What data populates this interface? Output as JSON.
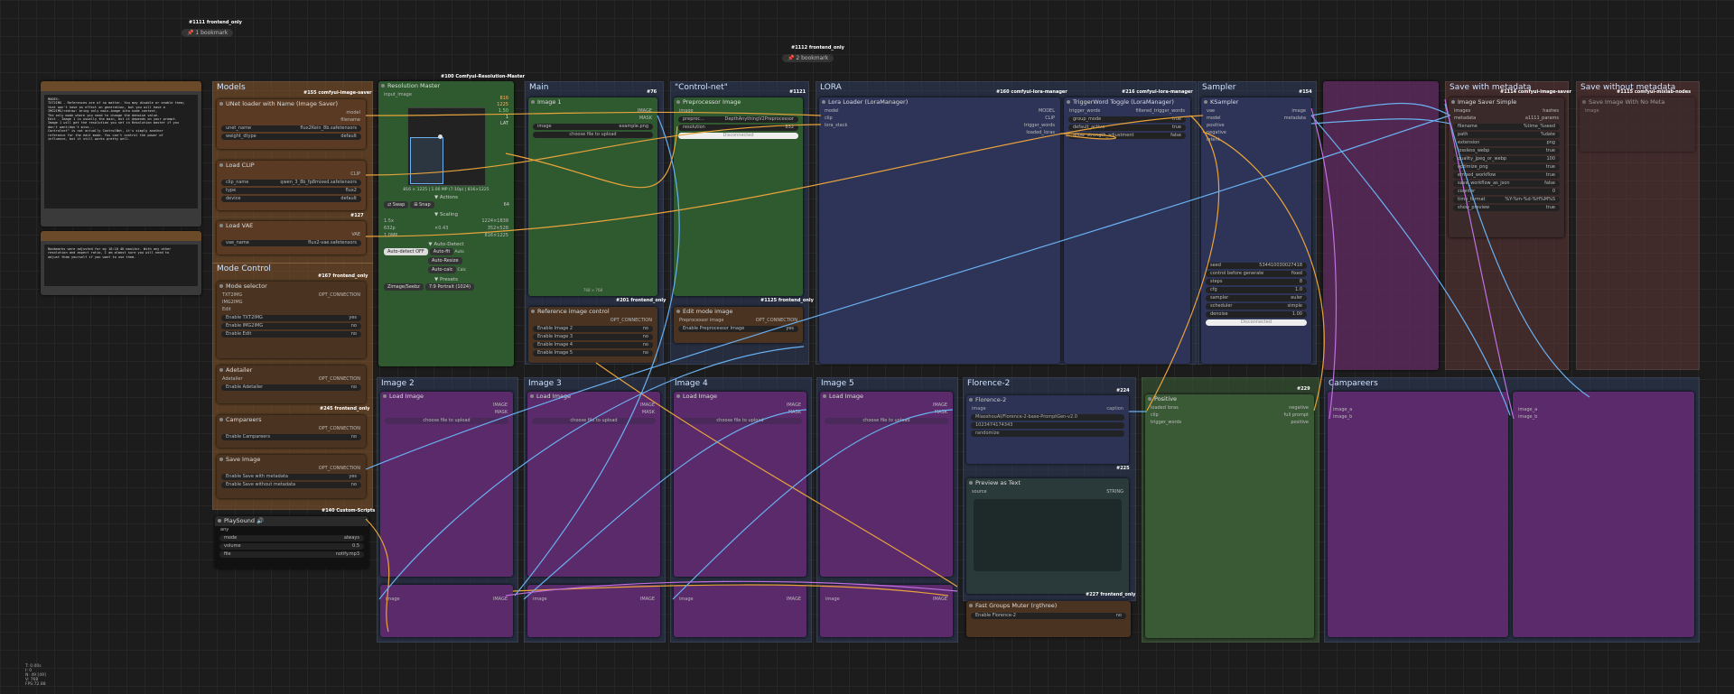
{
  "colors": {
    "orange_group": "#8a5a2b",
    "purple_group": "#5a2a5a",
    "green_group": "#3a5a36",
    "blue_group": "#2d3d5c",
    "wire_orange": "#e8a33c",
    "wire_blue": "#6ab0f0",
    "wire_purple": "#c070e0"
  },
  "tags": {
    "t1111": "#1111 frontend_only",
    "t1112": "#1112 frontend_only",
    "t155": "#155 comfyui-image-saver",
    "t100": "#100 Comfyui-Resolution-Master",
    "t76": "#76",
    "t1121": "#1121",
    "t160": "#160 comfyui-lora-manager",
    "t216": "#216 comfyui-lora-manager",
    "t154": "#154",
    "t1114": "#1114 comfyui-image-saver",
    "t1115": "#1115 comfyui-mixlab-nodes",
    "t127": "#127",
    "t167": "#167 frontend_only",
    "t201": "#201 frontend_only",
    "t1125": "#1125 frontend_only",
    "t245": "#245 frontend_only",
    "t140": "#140 Custom-Scripts",
    "t224": "#224",
    "t225": "#225",
    "t229": "#229",
    "t227": "#227 frontend_only"
  },
  "bookmarks": {
    "b1": "1 bookmark",
    "b2": "2 bookmark"
  },
  "groups": {
    "models": "Models",
    "mode_control": "Mode Control",
    "main": "Main",
    "controlnet": "\"Control-net\"",
    "lora": "LORA",
    "sampler": "Sampler",
    "save_meta": "Save with metadata",
    "save_nometa": "Save without metadata",
    "image2": "Image 2",
    "image3": "Image 3",
    "image4": "Image 4",
    "image5": "Image 5",
    "florence": "Florence-2",
    "campare": "Campareers"
  },
  "readme": {
    "title": "README",
    "text": "MODES:\nTXT2IMG - References are of no matter. You may disable or enable them; that won't have an effect on generation, but you will have a\nIMG2IMG/redraw: bring only main-image into node context,\nThe only mode where you need to change the denoise value.\nEdit - Image 1 is usually the main, but it depends on your prompt.\nImage 1 will get the resolution you set in Resolution master if you\ndon't want/don't miss...\nControlnet\" is not actually ControlNet, it's simply another\nreference for the edit mode. You can't control the power of\ninfluence, but it still works pretty well."
  },
  "bookmarks_note": {
    "title": "Bookmarks",
    "text": "Bookmarks were adjusted for my 16:10 4K monitor. With any other\nresolution and aspect ratio, I am almost sure you will need to\nadjust them yourself if you want to use them."
  },
  "unet": {
    "title": "UNet loader with Name (Image Saver)",
    "out1": "model",
    "out2": "filename",
    "name_label": "unet_name",
    "name_value": "flux2Kein_8b.safetensors",
    "dtype_label": "weight_dtype",
    "dtype_value": "default"
  },
  "clip": {
    "title": "Load CLIP",
    "out": "CLIP",
    "name_label": "clip_name",
    "name_value": "qwen_3_8b_fp8mixed.safetensors",
    "type_label": "type",
    "type_value": "flux2",
    "device_label": "device",
    "device_value": "default"
  },
  "vae": {
    "title": "Load VAE",
    "out": "VAE",
    "name_label": "vae_name",
    "name_value": "flux2-vae.safetensors"
  },
  "mode_selector": {
    "title": "Mode selector",
    "conn": "OPT_CONNECTION",
    "i1": "TXT2IMG",
    "i2": "IMG2IMG",
    "i3": "Edit",
    "e1": "Enable TXT2IMG",
    "e1v": "yes",
    "e2": "Enable IMG2IMG",
    "e2v": "no",
    "e3": "Enable Edit",
    "e3v": "no"
  },
  "adetailer": {
    "title": "Adetailer",
    "conn": "OPT_CONNECTION",
    "in": "Adetailer",
    "e": "Enable Adetailer",
    "ev": "no"
  },
  "campareers_ctl": {
    "title": "Campareers",
    "conn": "OPT_CONNECTION",
    "e": "Enable Campareers",
    "ev": "no"
  },
  "save_image": {
    "title": "Save Image",
    "conn": "OPT_CONNECTION",
    "e1": "Enable Save with metadata",
    "e1v": "yes",
    "e2": "Enable Save without metadata",
    "e2v": "no"
  },
  "playsound": {
    "title": "PlaySound 🔊",
    "in": "any",
    "mode_label": "mode",
    "mode_value": "always",
    "volume_label": "volume",
    "volume_value": "0.5",
    "file_label": "file",
    "file_value": "notify.mp3"
  },
  "resmaster": {
    "title": "Resolution Master",
    "in": "input_image",
    "w": "816",
    "h": "1225",
    "r1": "1.50",
    "r2": "1",
    "lat": "LAT",
    "info": "816 × 1225 | 1.00 MP (7:10p) | 816×1225",
    "actions": "▼ Actions",
    "swap": "⇄ Swap",
    "snap": "⊞ Snap",
    "snapv": "64",
    "scaling": "▼ Scaling",
    "sc1v": "1.5x",
    "sc1r": "1224×1838",
    "sc2": "632p",
    "sc2v": "×0.43",
    "sc2r": "352×528",
    "sc3v": "1.0MP",
    "sc3r": "816×1225",
    "autodetect": "▼ Auto-Detect",
    "ad_btn": "Auto-detect OFF",
    "autofit": "Auto-fit",
    "autoresize": "Auto-Resize",
    "autocalc": "Auto-calc",
    "auto": "Auto",
    "calc": "Calc",
    "presets": "▼ Presets",
    "preset1": "Zimage/Seebz",
    "preset2": "7:9 Portrait (1024)"
  },
  "image1": {
    "title": "Image 1",
    "o1": "IMAGE",
    "o2": "MASK",
    "img_label": "image",
    "img_value": "example.png",
    "upload": "choose file to upload",
    "res": "768 × 768"
  },
  "preproc": {
    "title": "Preprocessor Image",
    "o1": "image",
    "p_label": "preproc...",
    "p_value": "DepthAnythingV2Preprocessor",
    "res_label": "resolution",
    "res_value": "832",
    "disconnected": "Disconnected"
  },
  "refctl": {
    "title": "Reference image control",
    "conn": "OPT_CONNECTION",
    "e2": "Enable Image 2",
    "e3": "Enable Image 3",
    "e4": "Enable Image 4",
    "e5": "Enable Image 5",
    "v": "no"
  },
  "editmode": {
    "title": "Edit mode image",
    "in": "Preprocessor image",
    "conn": "OPT_CONNECTION",
    "e": "Enable Preprocessor Image",
    "ev": "yes"
  },
  "lora": {
    "title": "Lora Loader (LoraManager)",
    "i1": "model",
    "i2": "clip",
    "i3": "lora_stack",
    "o1": "MODEL",
    "o2": "CLIP",
    "o3": "trigger_words",
    "o4": "loaded_loras"
  },
  "trigger": {
    "title": "TriggerWord Toggle (LoraManager)",
    "in": "trigger_words",
    "out": "filtered_trigger_words",
    "w1": "group_mode",
    "w1v": "true",
    "w2": "default_active",
    "w2v": "true",
    "w3": "allow_strength_adjustment",
    "w3v": "false"
  },
  "ksampler": {
    "title": "KSampler",
    "i1": "vae",
    "i2": "model",
    "i3": "positive",
    "i4": "negative",
    "i5": "latent",
    "o1": "image",
    "o2": "metadata",
    "seed_label": "seed",
    "seed_value": "534410030027418",
    "cag_label": "control before generate",
    "cag_value": "fixed",
    "steps_label": "steps",
    "steps_value": "8",
    "cfg_label": "cfg",
    "cfg_value": "1.0",
    "sampler_label": "sampler",
    "sampler_value": "euler",
    "sched_label": "scheduler",
    "sched_value": "simple",
    "denoise_label": "denoise",
    "denoise_value": "1.00",
    "disconnected": "Disconnected"
  },
  "saver": {
    "title": "Image Saver Simple",
    "i1": "images",
    "i2": "metadata",
    "o1": "hashes",
    "o2": "a1111_params",
    "fn_label": "filename",
    "fn_value": "%time_%seed",
    "path_label": "path",
    "path_value": "%date",
    "ext_label": "extension",
    "ext_value": "png",
    "lossless_label": "lossless_webp",
    "lossless_value": "true",
    "q_label": "quality_jpeg_or_webp",
    "q_value": "100",
    "opt_label": "optimize_png",
    "opt_value": "true",
    "wf_label": "embed_workflow",
    "wf_value": "true",
    "swf_label": "save_workflow_as_json",
    "swf_value": "false",
    "cnt_label": "counter",
    "cnt_value": "0",
    "tf_label": "time_format",
    "tf_value": "%Y-%m-%d-%H%M%S",
    "prev_label": "show_preview",
    "prev_value": "true"
  },
  "saver2": {
    "title": "Save Image With No Meta",
    "in": "image"
  },
  "imgnode": {
    "title": "Load Image",
    "o1": "IMAGE",
    "o2": "MASK",
    "upload": "choose file to upload",
    "bottom_in": "image",
    "bottom_out": "IMAGE"
  },
  "florence_node": {
    "title": "Florence-2",
    "in": "image",
    "o1": "caption",
    "w1v": "MiaoshouAI/Florence-2-base-PromptGen-v2.0",
    "seed_v": "1023474174343",
    "ctrl_v": "randomize"
  },
  "florence_sub": {
    "title": "Preview as Text",
    "in": "source",
    "out": "STRING"
  },
  "positive": {
    "title": "Positive",
    "i1": "loaded loras",
    "i2": "clip",
    "i3": "trigger_words",
    "o1": "negative",
    "o2": "full prompt",
    "o3": "positive"
  },
  "fastmuter": {
    "title": "Fast Groups Muter (rgthree)",
    "e": "Enable Florence-2",
    "ev": "no"
  },
  "campare": {
    "i1": "image_a",
    "i2": "image_b"
  },
  "stats": {
    "l1": "T: 0.00s",
    "l2": "I: 0",
    "l3": "N: 49 [49]",
    "l4": "V: 768",
    "l5": "FPS:72.88"
  }
}
